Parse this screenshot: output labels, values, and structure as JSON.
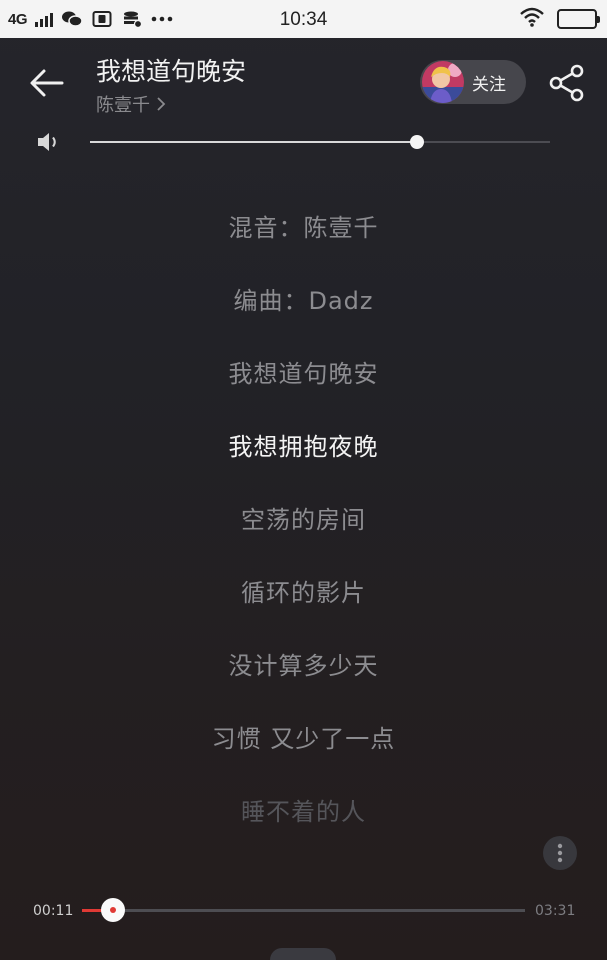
{
  "status_bar": {
    "network": "4G",
    "time": "10:34"
  },
  "header": {
    "title": "我想道句晚安",
    "artist": "陈壹千",
    "follow_label": "关注"
  },
  "volume": {
    "level": 0.71
  },
  "lyrics": [
    "混音：陈壹千",
    "编曲：Dadz",
    "我想道句晚安",
    "我想拥抱夜晚",
    "空荡的房间",
    "循环的影片",
    "没计算多少天",
    "习惯 又少了一点",
    "睡不着的人"
  ],
  "current_lyric_index": 3,
  "playback": {
    "elapsed": "00:11",
    "total": "03:31",
    "progress": 0.07
  },
  "icons": {
    "back": "back-arrow-icon",
    "share": "share-icon",
    "volume": "speaker-icon",
    "more": "more-vertical-icon"
  },
  "colors": {
    "accent": "#e03a35",
    "current_lyric": "#f3f3f3",
    "lyric": "#8c8c90"
  }
}
